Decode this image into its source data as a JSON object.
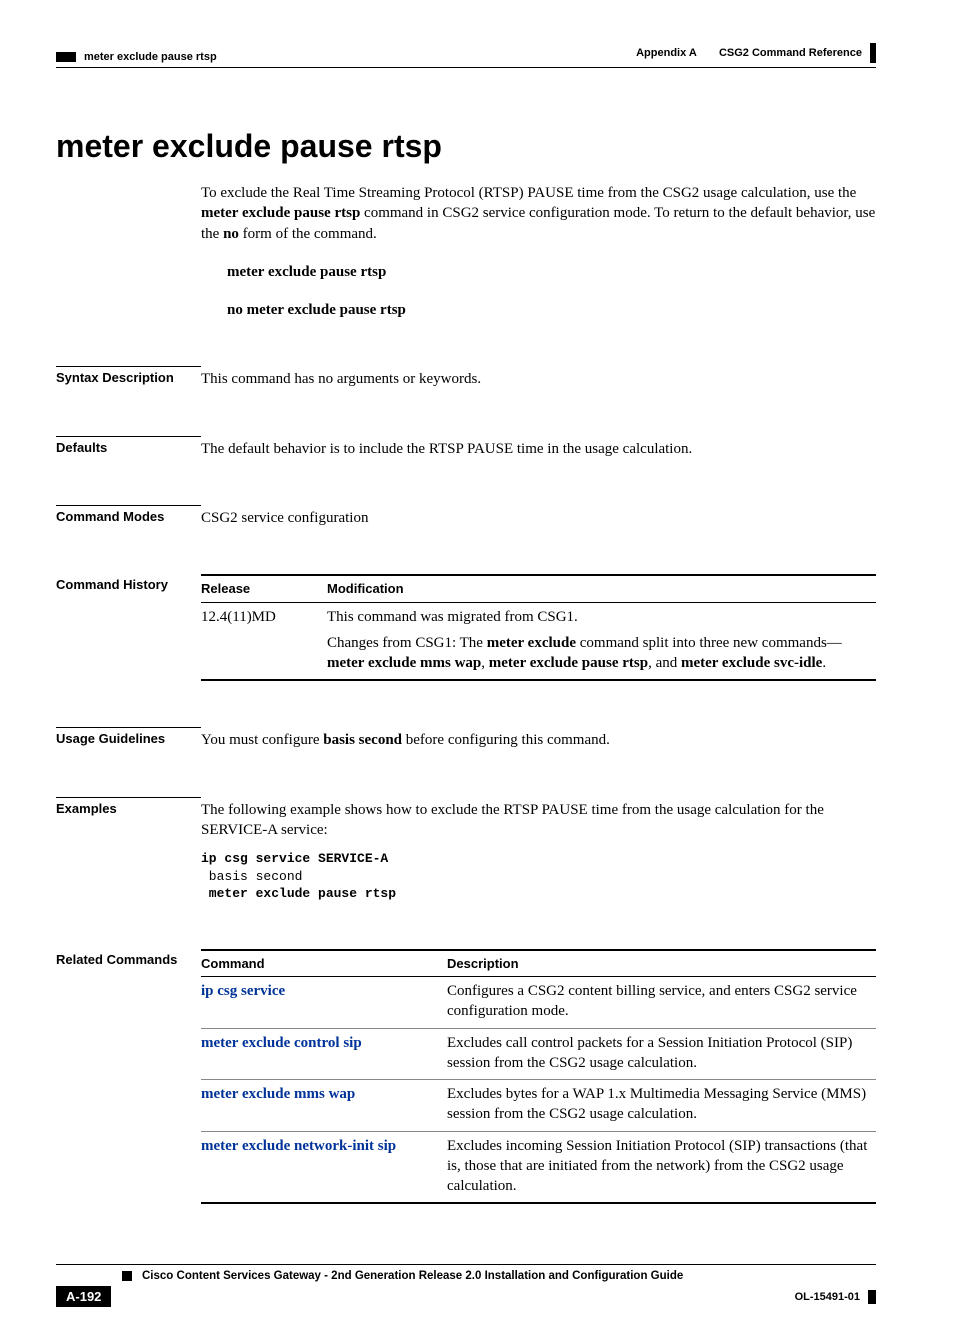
{
  "header": {
    "appendix": "Appendix A",
    "section_title": "CSG2 Command Reference",
    "running_head": "meter exclude pause rtsp"
  },
  "title": "meter exclude pause rtsp",
  "intro": {
    "p1a": "To exclude the Real Time Streaming Protocol (RTSP) PAUSE time from the CSG2 usage calculation, use the ",
    "p1b": "meter exclude pause rtsp",
    "p1c": " command in CSG2 service configuration mode. To return to the default behavior, use the ",
    "p1d": "no",
    "p1e": " form of the command.",
    "form1": "meter exclude pause rtsp",
    "form2": "no meter exclude pause rtsp"
  },
  "sections": {
    "syntax_label": "Syntax Description",
    "syntax_body": "This command has no arguments or keywords.",
    "defaults_label": "Defaults",
    "defaults_body": "The default behavior is to include the RTSP PAUSE time in the usage calculation.",
    "modes_label": "Command Modes",
    "modes_body": "CSG2 service configuration",
    "history_label": "Command History",
    "history_head_release": "Release",
    "history_head_mod": "Modification",
    "history_release": "12.4(11)MD",
    "history_mod_p1": "This command was migrated from CSG1.",
    "history_mod_p2a": "Changes from CSG1: The ",
    "history_mod_p2b": "meter exclude",
    "history_mod_p2c": " command split into three new commands—",
    "history_mod_p2d": "meter exclude mms wap",
    "history_mod_p2e": ", ",
    "history_mod_p2f": "meter exclude pause rtsp",
    "history_mod_p2g": ", and ",
    "history_mod_p2h": "meter exclude svc-idle",
    "history_mod_p2i": ".",
    "usage_label": "Usage Guidelines",
    "usage_a": "You must configure ",
    "usage_b": "basis second",
    "usage_c": " before configuring this command.",
    "examples_label": "Examples",
    "examples_intro": "The following example shows how to exclude the RTSP PAUSE time from the usage calculation for the SERVICE-A service:",
    "examples_code_l1": "ip csg service SERVICE-A",
    "examples_code_l2": " basis second",
    "examples_code_l3": " meter exclude pause rtsp",
    "related_label": "Related Commands",
    "related_head_cmd": "Command",
    "related_head_desc": "Description",
    "related": [
      {
        "cmd": "ip csg service",
        "desc": "Configures a CSG2 content billing service, and enters CSG2 service configuration mode."
      },
      {
        "cmd": "meter exclude control sip",
        "desc": "Excludes call control packets for a Session Initiation Protocol (SIP) session from the CSG2 usage calculation."
      },
      {
        "cmd": "meter exclude mms wap",
        "desc": "Excludes bytes for a WAP 1.x Multimedia Messaging Service (MMS) session from the CSG2 usage calculation."
      },
      {
        "cmd": "meter exclude network-init sip",
        "desc": "Excludes incoming Session Initiation Protocol (SIP) transactions (that is, those that are initiated from the network) from the CSG2 usage calculation."
      }
    ]
  },
  "footer": {
    "book_title": "Cisco Content Services Gateway - 2nd Generation Release 2.0 Installation and Configuration Guide",
    "page_num": "A-192",
    "doc_id": "OL-15491-01"
  }
}
